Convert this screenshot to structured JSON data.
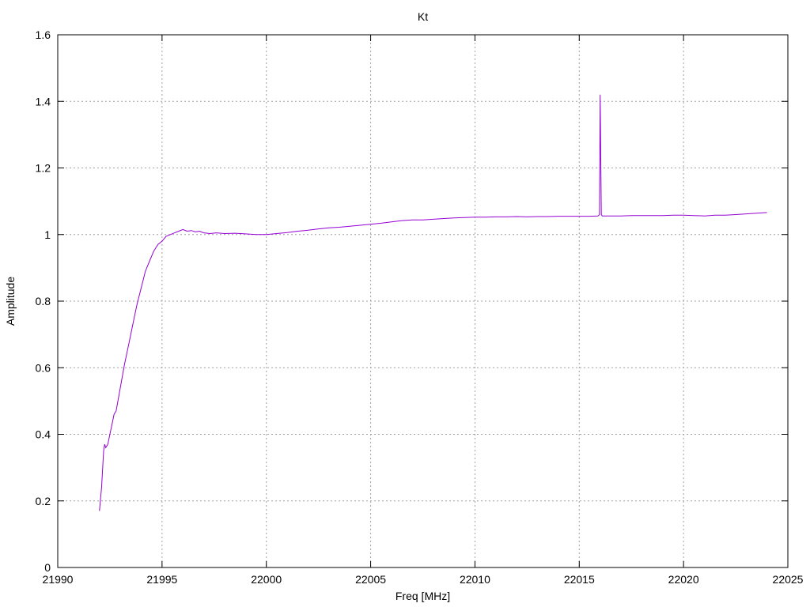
{
  "chart_data": {
    "type": "line",
    "title": "Kt",
    "xlabel": "Freq [MHz]",
    "ylabel": "Amplitude",
    "xlim": [
      21990,
      22025
    ],
    "ylim": [
      0,
      1.6
    ],
    "xticks": [
      21990,
      21995,
      22000,
      22005,
      22010,
      22015,
      22020,
      22025
    ],
    "yticks": [
      0,
      0.2,
      0.4,
      0.6,
      0.8,
      1,
      1.2,
      1.4,
      1.6
    ],
    "xtick_labels": [
      "21990",
      "21995",
      "22000",
      "22005",
      "22010",
      "22015",
      "22020",
      "22025"
    ],
    "ytick_labels": [
      "0",
      "0.2",
      "0.4",
      "0.6",
      "0.8",
      "1",
      "1.2",
      "1.4",
      "1.6"
    ],
    "grid": true,
    "line_color": "#9400d3",
    "series": [
      {
        "x": [
          21992.0,
          21992.1,
          21992.2,
          21992.25,
          21992.3,
          21992.4,
          21992.5,
          21992.6,
          21992.7,
          21992.8,
          21993.0,
          21993.2,
          21993.4,
          21993.6,
          21993.8,
          21994.0,
          21994.2,
          21994.4,
          21994.6,
          21994.8,
          21995.0,
          21995.2,
          21995.4,
          21995.6,
          21995.8,
          21996.0,
          21996.2,
          21996.4,
          21996.6,
          21996.8,
          21997.0,
          21997.3,
          21997.6,
          21998.0,
          21998.5,
          21999.0,
          21999.5,
          22000.0,
          22000.5,
          22001.0,
          22001.5,
          22002.0,
          22002.5,
          22003.0,
          22003.5,
          22004.0,
          22004.5,
          22005.0,
          22005.5,
          22006.0,
          22006.5,
          22007.0,
          22007.5,
          22008.0,
          22008.5,
          22009.0,
          22009.5,
          22010.0,
          22010.5,
          22011.0,
          22011.5,
          22012.0,
          22012.5,
          22013.0,
          22013.5,
          22014.0,
          22014.5,
          22015.0,
          22015.5,
          22015.9,
          22015.97,
          22016.0,
          22016.03,
          22016.06,
          22016.1,
          22016.5,
          22017.0,
          22017.5,
          22018.0,
          22018.5,
          22019.0,
          22019.5,
          22020.0,
          22020.5,
          22021.0,
          22021.5,
          22022.0,
          22022.5,
          22023.0,
          22023.5,
          22024.0
        ],
        "y": [
          0.17,
          0.24,
          0.35,
          0.37,
          0.36,
          0.37,
          0.4,
          0.43,
          0.46,
          0.47,
          0.54,
          0.61,
          0.67,
          0.73,
          0.79,
          0.84,
          0.89,
          0.92,
          0.95,
          0.97,
          0.98,
          0.995,
          1.0,
          1.005,
          1.01,
          1.015,
          1.01,
          1.012,
          1.008,
          1.01,
          1.005,
          1.003,
          1.005,
          1.003,
          1.004,
          1.002,
          1.0,
          1.0,
          1.003,
          1.006,
          1.01,
          1.013,
          1.017,
          1.02,
          1.022,
          1.025,
          1.028,
          1.031,
          1.034,
          1.038,
          1.042,
          1.044,
          1.044,
          1.046,
          1.048,
          1.05,
          1.051,
          1.052,
          1.052,
          1.053,
          1.053,
          1.054,
          1.053,
          1.054,
          1.054,
          1.055,
          1.055,
          1.055,
          1.055,
          1.056,
          1.06,
          1.42,
          1.25,
          1.06,
          1.056,
          1.056,
          1.056,
          1.057,
          1.057,
          1.057,
          1.057,
          1.058,
          1.058,
          1.057,
          1.056,
          1.058,
          1.058,
          1.06,
          1.062,
          1.064,
          1.066
        ]
      }
    ]
  }
}
